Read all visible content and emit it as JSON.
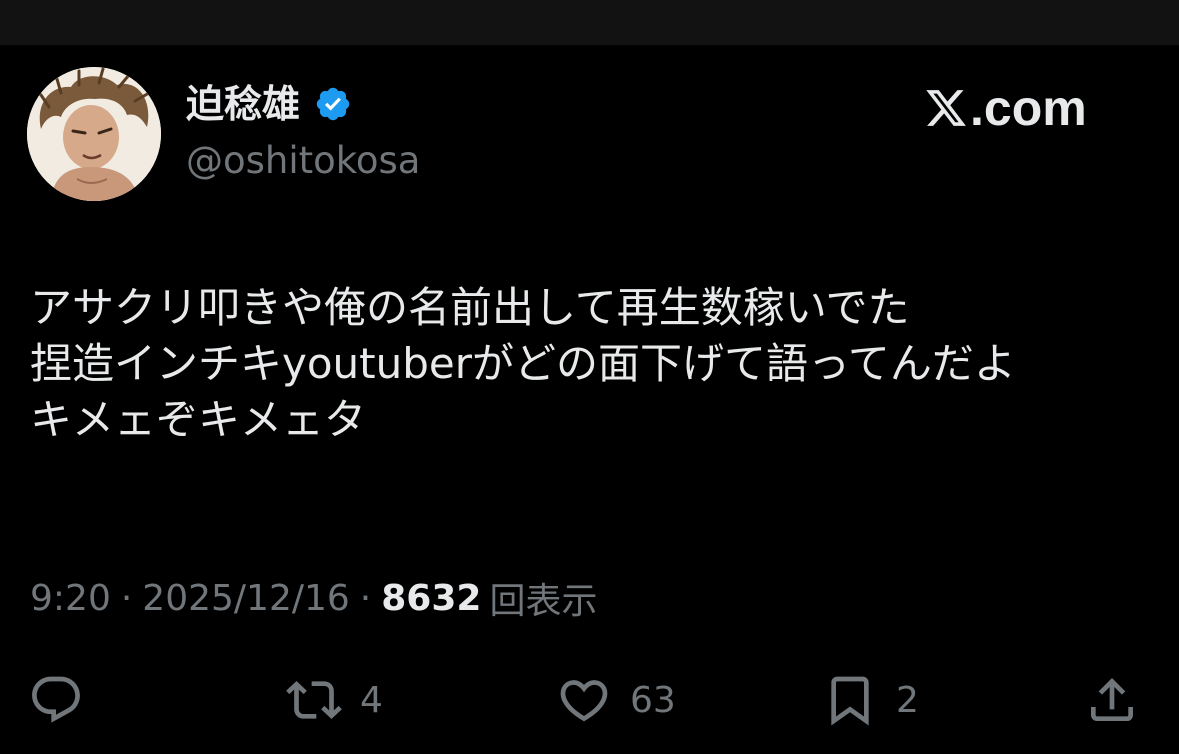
{
  "author": {
    "display_name": "迫稔雄",
    "handle": "@oshitokosa",
    "verified": true,
    "verified_color": "#1d9bf0"
  },
  "brand": {
    "label": ".com",
    "icon": "x-logo-icon"
  },
  "tweet": {
    "lines": [
      "アサクリ叩きや俺の名前出して再生数稼いでた",
      "捏造インチキyoutuberがどの面下げて語ってんだよ",
      "キメェぞキメェタ"
    ]
  },
  "meta": {
    "time": "9:20",
    "separator": "·",
    "date": "2025/12/16",
    "views_count": "8632",
    "views_label": "回表示"
  },
  "actions": {
    "reply": {
      "icon": "reply-icon",
      "count": ""
    },
    "retweet": {
      "icon": "retweet-icon",
      "count": "4"
    },
    "like": {
      "icon": "heart-icon",
      "count": "63"
    },
    "bookmark": {
      "icon": "bookmark-icon",
      "count": "2"
    },
    "share": {
      "icon": "share-icon",
      "count": ""
    }
  },
  "colors": {
    "background": "#000000",
    "primary_text": "#e7e9ea",
    "secondary_text": "#71767b"
  }
}
